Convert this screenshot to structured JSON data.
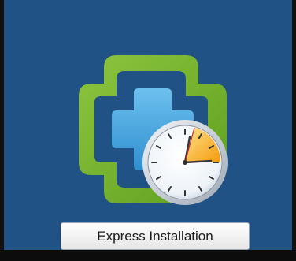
{
  "installer": {
    "button_label": "Express Installation",
    "icon": "vcenter-install-clock-icon"
  },
  "colors": {
    "background": "#205286",
    "outer_cross": "#76b72a",
    "inner_cross": "#3f9fd9",
    "clock_accent": "#f7a81b",
    "bottom_strip": "#0c0c0c"
  }
}
